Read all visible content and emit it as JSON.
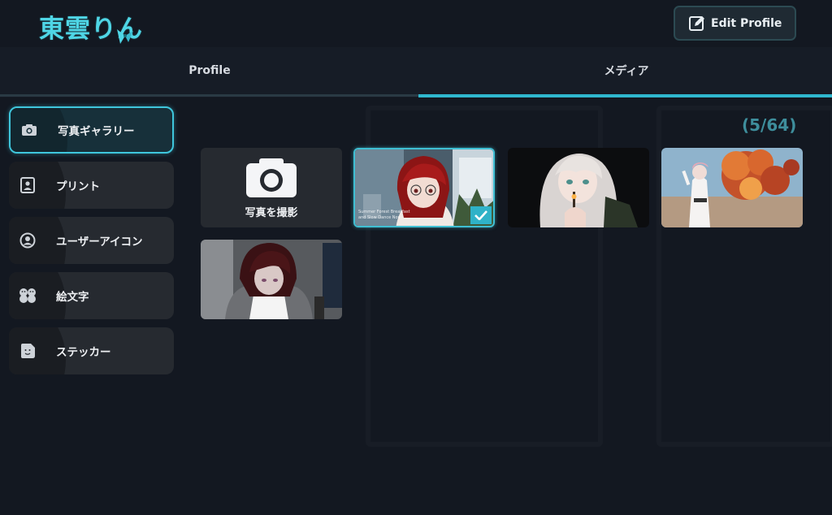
{
  "app": {
    "logo_text": "東雲りん",
    "edit_profile_label": "Edit Profile"
  },
  "tabs": [
    {
      "label": "Profile",
      "active": false
    },
    {
      "label": "メディア",
      "active": true
    }
  ],
  "sidebar": {
    "items": [
      {
        "label": "写真ギャラリー",
        "icon": "camera-icon",
        "active": true
      },
      {
        "label": "プリント",
        "icon": "print-icon",
        "active": false
      },
      {
        "label": "ユーザーアイコン",
        "icon": "user-icon",
        "active": false
      },
      {
        "label": "絵文字",
        "icon": "emoji-icon",
        "active": false
      },
      {
        "label": "ステッカー",
        "icon": "sticker-icon",
        "active": false
      }
    ]
  },
  "gallery": {
    "count_text": "(5/64)",
    "capture_label": "写真を撮影",
    "photos": [
      {
        "caption": "Summer Forest Breakfast\nand Slow Dance Nov",
        "selected": true
      },
      {
        "caption": "",
        "selected": false
      },
      {
        "caption": "",
        "selected": false
      },
      {
        "caption": "",
        "selected": false
      }
    ]
  },
  "colors": {
    "accent": "#3fc6dc",
    "background": "#131821",
    "tile": "#262a30"
  }
}
